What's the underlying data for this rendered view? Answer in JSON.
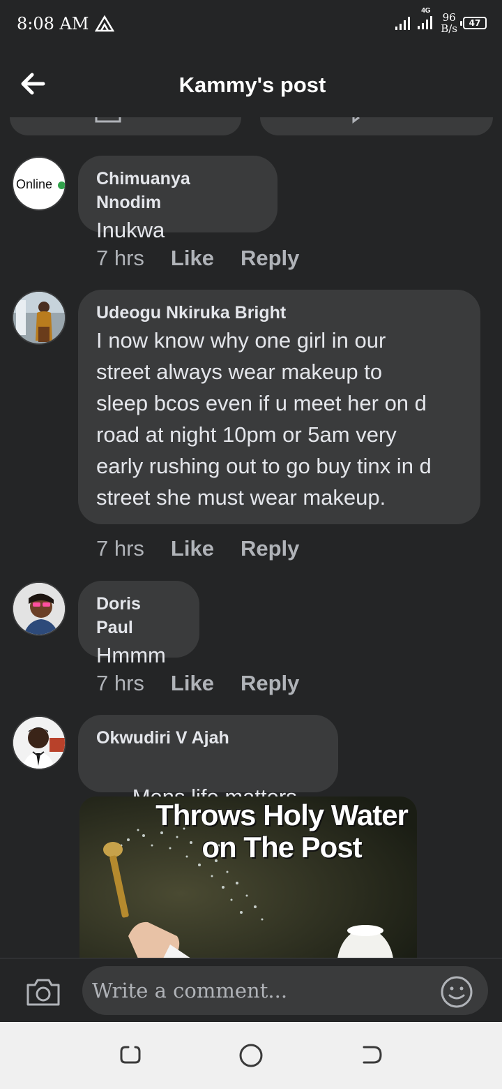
{
  "status_bar": {
    "time": "8:08 AM",
    "network_type": "4G",
    "net_rate_value": "96",
    "net_rate_unit": "B/s",
    "battery": "47"
  },
  "header": {
    "title": "Kammy's post",
    "back_icon": "back-arrow-icon"
  },
  "comments": [
    {
      "author": "Chimuanya Nnodim",
      "text": "Inukwa",
      "avatar_label": "Online",
      "time": "7 hrs",
      "like_label": "Like",
      "reply_label": "Reply"
    },
    {
      "author": "Udeogu Nkiruka Bright",
      "text": "I now know why one girl in our\nstreet always wear makeup to\nsleep bcos even if u meet her on d\nroad at night 10pm or 5am very\nearly rushing out to go buy tinx in d\nstreet she must wear makeup.",
      "time": "7 hrs",
      "like_label": "Like",
      "reply_label": "Reply"
    },
    {
      "author": "Doris Paul",
      "text": "Hmmm",
      "time": "7 hrs",
      "like_label": "Like",
      "reply_label": "Reply"
    },
    {
      "author": "Okwudiri V Ajah",
      "text": "Mens life matters",
      "emoji": "😪",
      "attachment_caption": "Throws Holy Water\non The Post"
    }
  ],
  "composer": {
    "placeholder": "Write a comment...",
    "camera_icon": "camera-icon",
    "emoji_icon": "smiley-icon"
  },
  "colors": {
    "background": "#242526",
    "bubble": "#3a3b3c",
    "text_primary": "#e4e6eb",
    "text_secondary": "#b0b3b8",
    "online_dot": "#31a24c",
    "nav_bar": "#f0f0f0"
  }
}
